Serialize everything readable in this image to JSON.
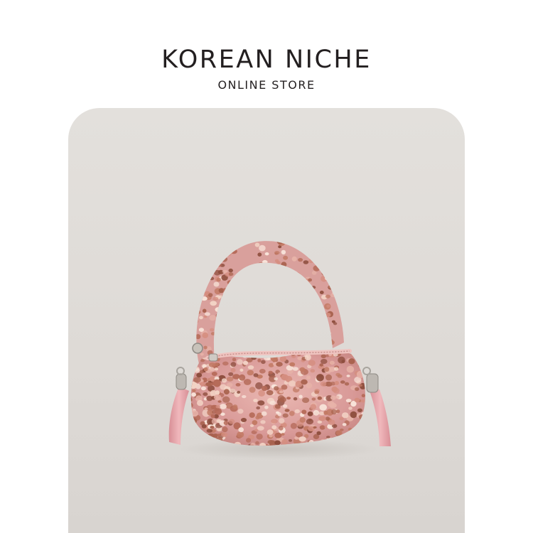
{
  "brand": {
    "title": "KOREAN NICHE",
    "subtitle": "ONLINE STORE"
  },
  "product_image": {
    "subject": "pink sequin shoulder bag",
    "colors": {
      "background": "#ffffff",
      "card": "#dfdbd7",
      "bag_base": "#e0a8a6",
      "sequin_dark": "#9a5a48",
      "sequin_light": "#f4d8cc",
      "strap": "#e8a8ae",
      "hardware": "#b8b4ae"
    }
  }
}
